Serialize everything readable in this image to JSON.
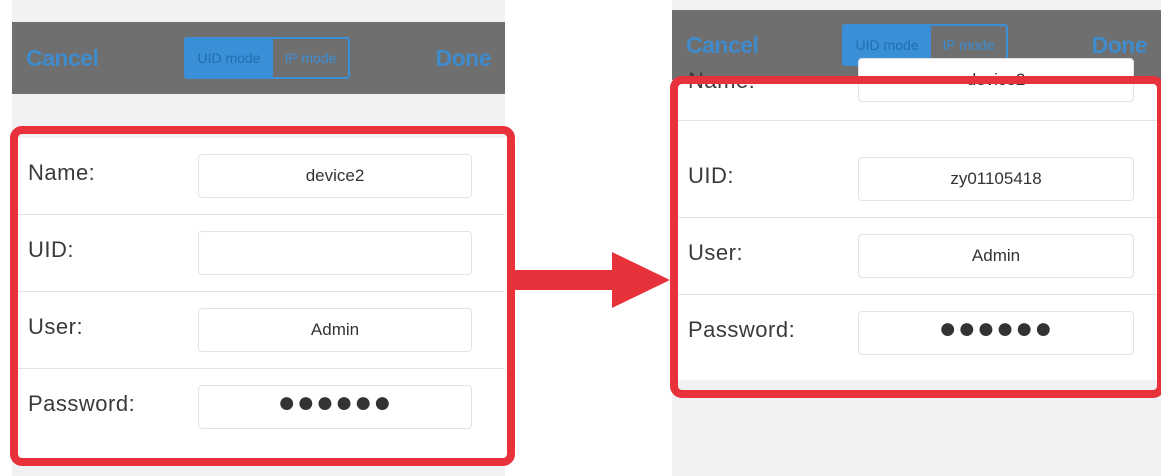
{
  "before": {
    "navbar": {
      "cancel": "Cancel",
      "done": "Done",
      "segments": [
        "UID mode",
        "IP mode"
      ],
      "active_segment": "UID mode"
    },
    "fields": [
      {
        "label": "Name:",
        "value": "device2"
      },
      {
        "label": "UID:",
        "value": ""
      },
      {
        "label": "User:",
        "value": "Admin"
      },
      {
        "label": "Password:",
        "value": "●●●●●●"
      }
    ]
  },
  "after": {
    "navbar": {
      "cancel": "Cancel",
      "done": "Done",
      "segments": [
        "UID mode",
        "IP mode"
      ],
      "active_segment": "UID mode"
    },
    "fields": [
      {
        "label": "Name:",
        "value": "device2"
      },
      {
        "label": "UID:",
        "value": "zy01105418"
      },
      {
        "label": "User:",
        "value": "Admin"
      },
      {
        "label": "Password:",
        "value": "●●●●●●"
      }
    ]
  },
  "colors": {
    "highlight": "#e8323b",
    "accent": "#3a8fd6",
    "navbar": "#6f6f6f"
  },
  "icons": {
    "transition": "right-arrow-icon"
  }
}
